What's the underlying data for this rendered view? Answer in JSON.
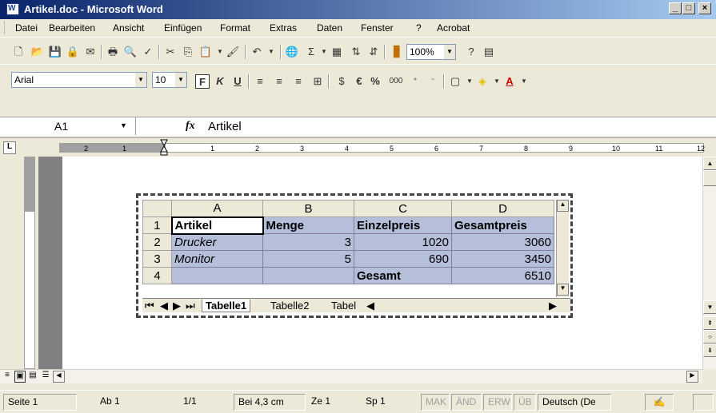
{
  "window": {
    "title": "Artikel.doc - Microsoft Word",
    "app_icon_letter": "W",
    "minimize": "_",
    "maximize": "□",
    "close": "×"
  },
  "menu": [
    "Datei",
    "Bearbeiten",
    "Ansicht",
    "Einfügen",
    "Format",
    "Extras",
    "Daten",
    "Fenster",
    "?",
    "Acrobat"
  ],
  "standard_toolbar": {
    "zoom": "100%"
  },
  "format_toolbar": {
    "font": "Arial",
    "size": "10",
    "bold": "F",
    "italic": "K",
    "underline": "U",
    "currency": "€",
    "percent": "%",
    "thousands": "000"
  },
  "formula_bar": {
    "cell_ref": "A1",
    "fx": "fx",
    "content": "Artikel"
  },
  "ruler": {
    "ticks": [
      "2",
      "1",
      "1",
      "2",
      "3",
      "4",
      "5",
      "6",
      "7",
      "8",
      "9",
      "10",
      "11",
      "12"
    ]
  },
  "sheet": {
    "columns": [
      "A",
      "B",
      "C",
      "D"
    ],
    "rows": [
      {
        "num": "1",
        "cells": [
          "Artikel",
          "Menge",
          "Einzelpreis",
          "Gesamtpreis"
        ]
      },
      {
        "num": "2",
        "cells": [
          "Drucker",
          "3",
          "1020",
          "3060"
        ]
      },
      {
        "num": "3",
        "cells": [
          "Monitor",
          "5",
          "690",
          "3450"
        ]
      },
      {
        "num": "4",
        "cells": [
          "",
          "",
          "Gesamt",
          "6510"
        ]
      }
    ],
    "tabs": [
      "Tabelle1",
      "Tabelle2",
      "Tabel"
    ]
  },
  "statusbar": {
    "page": "Seite 1",
    "section": "Ab 1",
    "pages": "1/1",
    "position": "Bei 4,3 cm",
    "line": "Ze 1",
    "column": "Sp 1",
    "mak": "MAK",
    "and": "ÄND",
    "erw": "ERW",
    "ub": "ÜB",
    "language": "Deutsch (De"
  }
}
